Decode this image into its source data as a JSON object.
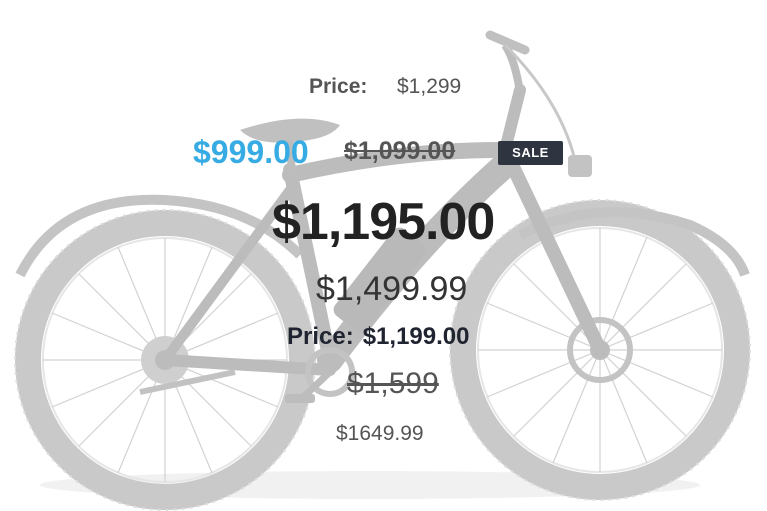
{
  "price_blocks": {
    "block1": {
      "label": "Price:",
      "value": "$1,299"
    },
    "sale": {
      "sale_price": "$999.00",
      "original_price": "$1,099.00",
      "badge": "SALE"
    },
    "big_price": "$1,195.00",
    "mid_price": "$1,499.99",
    "block4": {
      "label": "Price:",
      "value": "$1,199.00"
    },
    "strike_price": "$1,599",
    "small_price": "$1649.99"
  },
  "colors": {
    "sale_blue": "#37abe4",
    "badge_bg": "#2e3440",
    "dark_text": "#222222",
    "gray_text": "#555555"
  },
  "image": {
    "subject": "bike-icon"
  }
}
